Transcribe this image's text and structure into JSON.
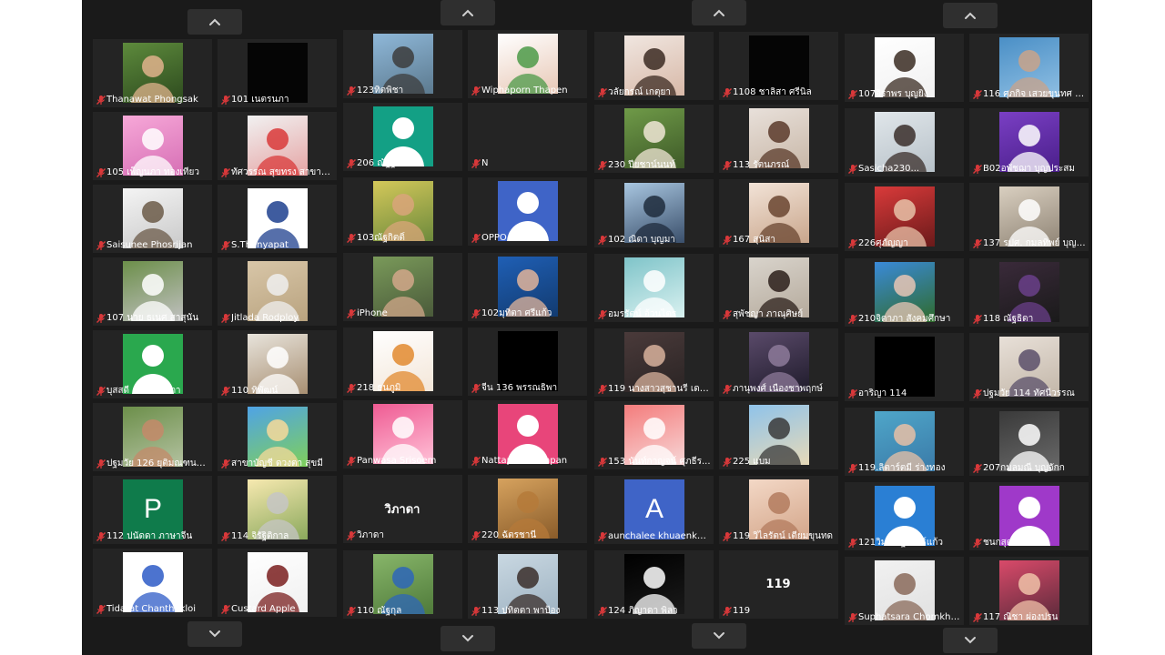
{
  "colors": {
    "background": "#1a1a1a",
    "tile": "#242424",
    "mic_muted": "#d9383a",
    "nav": "#2f2f2f"
  },
  "icons": {
    "mic": "mic-muted-icon",
    "up": "chevron-up-icon",
    "down": "chevron-down-icon"
  },
  "panels": [
    {
      "tiles": [
        {
          "name": "Thanawat Phongsak",
          "type": "photo",
          "c1": "#5d8a3c",
          "c2": "#2d4a1e",
          "c3": "#e0b38c"
        },
        {
          "name": "101 เนตรนภา",
          "type": "blank",
          "bg": "#050505"
        },
        {
          "name": "105 เพ็ญนภา ทองเทียว",
          "type": "photo",
          "c1": "#f7a8d8",
          "c2": "#d66fb5",
          "c3": "#ffffff"
        },
        {
          "name": "ทัศวรรณ สุขทรง สาขากา...",
          "type": "photo",
          "c1": "#f1f1f1",
          "c2": "#e5a4a4",
          "c3": "#d93a3a"
        },
        {
          "name": "Saisunee Phosrijan",
          "type": "photo",
          "c1": "#f4f4f4",
          "c2": "#c9c9c9",
          "c3": "#6b5a48"
        },
        {
          "name": "S.Thanyapat",
          "type": "photo",
          "c1": "#ffffff",
          "c2": "#ffffff",
          "c3": "#1d3f8e"
        },
        {
          "name": "107 นาย ธเนศ สาสุนัน",
          "type": "photo",
          "c1": "#6c8f4a",
          "c2": "#c0c0c0",
          "c3": "#ffffff"
        },
        {
          "name": "Jitlada Rodploy",
          "type": "photo",
          "c1": "#d8c6a8",
          "c2": "#b9a37f",
          "c3": "#efefef"
        },
        {
          "name": "บุสสดี อากาศโสภา",
          "type": "avatar",
          "bg": "#2aa84e"
        },
        {
          "name": "110 ทิพัฒน์",
          "type": "photo",
          "c1": "#e8e4dc",
          "c2": "#a88f72",
          "c3": "#ffffff"
        },
        {
          "name": "ปฐมวัย 126 ยุติมณฑนต์ น...",
          "type": "photo",
          "c1": "#6c8f4a",
          "c2": "#b4c2a1",
          "c3": "#c48a6a"
        },
        {
          "name": "สาขาบัญชี ดวงตา สุขมี",
          "type": "photo",
          "c1": "#4fa3e6",
          "c2": "#7fd05a",
          "c3": "#f7d99a"
        },
        {
          "name": "112 ปนัดดา ภาษาจีน",
          "type": "letter",
          "bg": "#0f7b4b",
          "letter": "P"
        },
        {
          "name": "114 จิรัฐิติกาล",
          "type": "photo",
          "c1": "#f7e9b0",
          "c2": "#8aa85c",
          "c3": "#c6c6c6"
        },
        {
          "name": "Tidarat Chanthakloi",
          "type": "photo",
          "c1": "#ffffff",
          "c2": "#ffffff",
          "c3": "#2d5bc7"
        },
        {
          "name": "Custard Apple",
          "type": "photo",
          "c1": "#ffffff",
          "c2": "#f0f0f0",
          "c3": "#7a1f1f"
        }
      ]
    },
    {
      "tiles": [
        {
          "name": "123ทิตพิชา",
          "type": "photo",
          "c1": "#8fb8d9",
          "c2": "#5c7a8f",
          "c3": "#3c3c3c"
        },
        {
          "name": "Wiphaporn Thapen",
          "type": "photo",
          "c1": "#ffffff",
          "c2": "#e8c8b6",
          "c3": "#4c9a48"
        },
        {
          "name": "206 ณัฐฐณิชา",
          "type": "avatar",
          "bg": "#13a085"
        },
        {
          "name": "N",
          "type": "mosaic",
          "cells": [
            "#1e88e5",
            "#ffffff",
            "#64b5f6",
            "#90caf9",
            "#1976d2",
            "#bbdefb",
            "#42a5f5",
            "#e3f2fd",
            "#1565c0"
          ]
        },
        {
          "name": "103ณัฐกิตติ์",
          "type": "photo",
          "c1": "#d4c85a",
          "c2": "#6d8a3c",
          "c3": "#d9a57a"
        },
        {
          "name": "OPPO Reno4",
          "type": "avatar",
          "bg": "#3f64c7"
        },
        {
          "name": "iPhone",
          "type": "photo",
          "c1": "#7a9a5a",
          "c2": "#4a5a3a",
          "c3": "#d2a78a"
        },
        {
          "name": "102มุทิตา ศรีแก้ว",
          "type": "photo",
          "c1": "#1f5fb5",
          "c2": "#123b70",
          "c3": "#e2b49a"
        },
        {
          "name": "218 ธนภูมิ",
          "type": "photo",
          "c1": "#ffffff",
          "c2": "#f3e6d8",
          "c3": "#e28a2f"
        },
        {
          "name": "จีน 136 พรรณธิพา",
          "type": "blank",
          "bg": "#000000"
        },
        {
          "name": "Panwasa Srisoem",
          "type": "photo",
          "c1": "#ef5b93",
          "c2": "#ffc1d7",
          "c3": "#ffffff"
        },
        {
          "name": "Nattaporn Inimpan",
          "type": "avatar",
          "bg": "#e8457a"
        },
        {
          "name": "วิภาดา",
          "type": "text",
          "text": "วิภาดา"
        },
        {
          "name": "220 ฉัตรชานี",
          "type": "photo",
          "c1": "#d6a25e",
          "c2": "#8a5c2a",
          "c3": "#b57a3a"
        },
        {
          "name": "110 ณัฐกุล",
          "type": "photo",
          "c1": "#88b66a",
          "c2": "#4f7a3a",
          "c3": "#2e66b8"
        },
        {
          "name": "113 ปทิตตา พาป้อง",
          "type": "photo",
          "c1": "#c9d8e2",
          "c2": "#9fb3c2",
          "c3": "#3a2e2a"
        }
      ]
    },
    {
      "tiles": [
        {
          "name": "วลัยกรณ์ เกตุยา",
          "type": "photo",
          "c1": "#f0e6e0",
          "c2": "#d8b9a8",
          "c3": "#3b2a22"
        },
        {
          "name": "1108 ชาลิสา ศรีนิล",
          "type": "blank",
          "bg": "#050505"
        },
        {
          "name": "230 ปียชาน์นนท์",
          "type": "photo",
          "c1": "#6f9a48",
          "c2": "#3e5a28",
          "c3": "#f0e6d6"
        },
        {
          "name": "113 รัตนภรณ์",
          "type": "photo",
          "c1": "#e8e0da",
          "c2": "#c9b8a8",
          "c3": "#5a3a2a"
        },
        {
          "name": "102 ณิดา บุญมา",
          "type": "photo",
          "c1": "#a8c6e0",
          "c2": "#3a4f6b",
          "c3": "#1f2b3c"
        },
        {
          "name": "167 สุนิสา",
          "type": "photo",
          "c1": "#f2e3d7",
          "c2": "#c9a68c",
          "c3": "#6a4530"
        },
        {
          "name": "อมรรัตน์ อ้วนไตร",
          "type": "photo",
          "c1": "#7fc4c9",
          "c2": "#d9f1f0",
          "c3": "#ffffff"
        },
        {
          "name": "สุพัชญา ภาณุศิษย์",
          "type": "photo",
          "c1": "#d9d4cc",
          "c2": "#b5aa9c",
          "c3": "#2b1f1a"
        },
        {
          "name": "119 นางสาวสุชานรี เดชศิริ",
          "type": "photo",
          "c1": "#4a3a3a",
          "c2": "#2a2424",
          "c3": "#d8b19c"
        },
        {
          "name": "ภานุพงศ์ เนื่องชาพฤกษ์",
          "type": "photo",
          "c1": "#5a4a6a",
          "c2": "#1f1b2b",
          "c3": "#8d7a9a"
        },
        {
          "name": "153 นันท์กาญจน์ ศุภธีร...",
          "type": "photo",
          "c1": "#f47c7c",
          "c2": "#f7d6d6",
          "c3": "#ffffff"
        },
        {
          "name": "225 แบม",
          "type": "photo",
          "c1": "#8fc3ea",
          "c2": "#e6d9b8",
          "c3": "#3a3a3a"
        },
        {
          "name": "aunchalee khuaenkhan",
          "type": "letter",
          "bg": "#3f64c7",
          "letter": "A"
        },
        {
          "name": "119 วิไลรัตน์ เตียมขุนทด",
          "type": "photo",
          "c1": "#f3d8c6",
          "c2": "#d3a589",
          "c3": "#b37b5e"
        },
        {
          "name": "124 ภิญาดา พิลา",
          "type": "photo",
          "c1": "#000000",
          "c2": "#1a1a1a",
          "c3": "#ffffff"
        },
        {
          "name": "119",
          "type": "text",
          "text": "119"
        }
      ]
    },
    {
      "tiles": [
        {
          "name": "107จิราพร บุญยิ่ง",
          "type": "photo",
          "c1": "#ffffff",
          "c2": "#f1f1f1",
          "c3": "#3a2b22"
        },
        {
          "name": "116 ศุภกิจ เสวยขุนทศ เค...",
          "type": "photo",
          "c1": "#4a8fc6",
          "c2": "#8fbfe3",
          "c3": "#c9a389"
        },
        {
          "name": "Sasicha230...",
          "type": "photo",
          "c1": "#e0e6ea",
          "c2": "#b8c2c9",
          "c3": "#3a2e2a"
        },
        {
          "name": "B02อพัชฌา บุญประสม",
          "type": "photo",
          "c1": "#7a3fc4",
          "c2": "#4a1f8a",
          "c3": "#ffffff"
        },
        {
          "name": "226ศุภัญญา",
          "type": "photo",
          "c1": "#d93a3a",
          "c2": "#6a1a1a",
          "c3": "#e8c2a8"
        },
        {
          "name": "137 รปศ. กมลทิพย์ บุญร...",
          "type": "photo",
          "c1": "#d9cfc0",
          "c2": "#8f8475",
          "c3": "#ffffff"
        },
        {
          "name": "210จิดาภา สังคมศึกษา",
          "type": "photo",
          "c1": "#3a8ad9",
          "c2": "#2f6b2a",
          "c3": "#e8c6b5"
        },
        {
          "name": "118 ณัฐธิดา",
          "type": "photo",
          "c1": "#3a2a3a",
          "c2": "#1a1a1a",
          "c3": "#6a3f8a"
        },
        {
          "name": "อาริญา 114",
          "type": "blank",
          "bg": "#000000"
        },
        {
          "name": "ปฐมวัย 114 ทัศนีวรรณ",
          "type": "photo",
          "c1": "#e8e0d8",
          "c2": "#c2b6a8",
          "c3": "#5a4f6a"
        },
        {
          "name": "119.ลิตาร์ตมี่ ร่างทอง",
          "type": "photo",
          "c1": "#4fa6c9",
          "c2": "#3a7aa8",
          "c3": "#e8c0a6"
        },
        {
          "name": "207กมลมณี บุญจักก",
          "type": "photo",
          "c1": "#3a3a3a",
          "c2": "#6a6a6a",
          "c3": "#ffffff"
        },
        {
          "name": "121วิมลณัฐ พันธ์แก้ว",
          "type": "avatar",
          "bg": "#2a7fd4"
        },
        {
          "name": "ชนกสุดา 122",
          "type": "avatar",
          "bg": "#9f39c9"
        },
        {
          "name": "Suphatsara Chomkho...",
          "type": "photo",
          "c1": "#f1f1f1",
          "c2": "#e1e1e1",
          "c3": "#8a6a5a"
        },
        {
          "name": "117 ณิชา ผ่องปรน",
          "type": "photo",
          "c1": "#d94a6a",
          "c2": "#5a2a3a",
          "c3": "#f0c2a8"
        }
      ]
    }
  ]
}
